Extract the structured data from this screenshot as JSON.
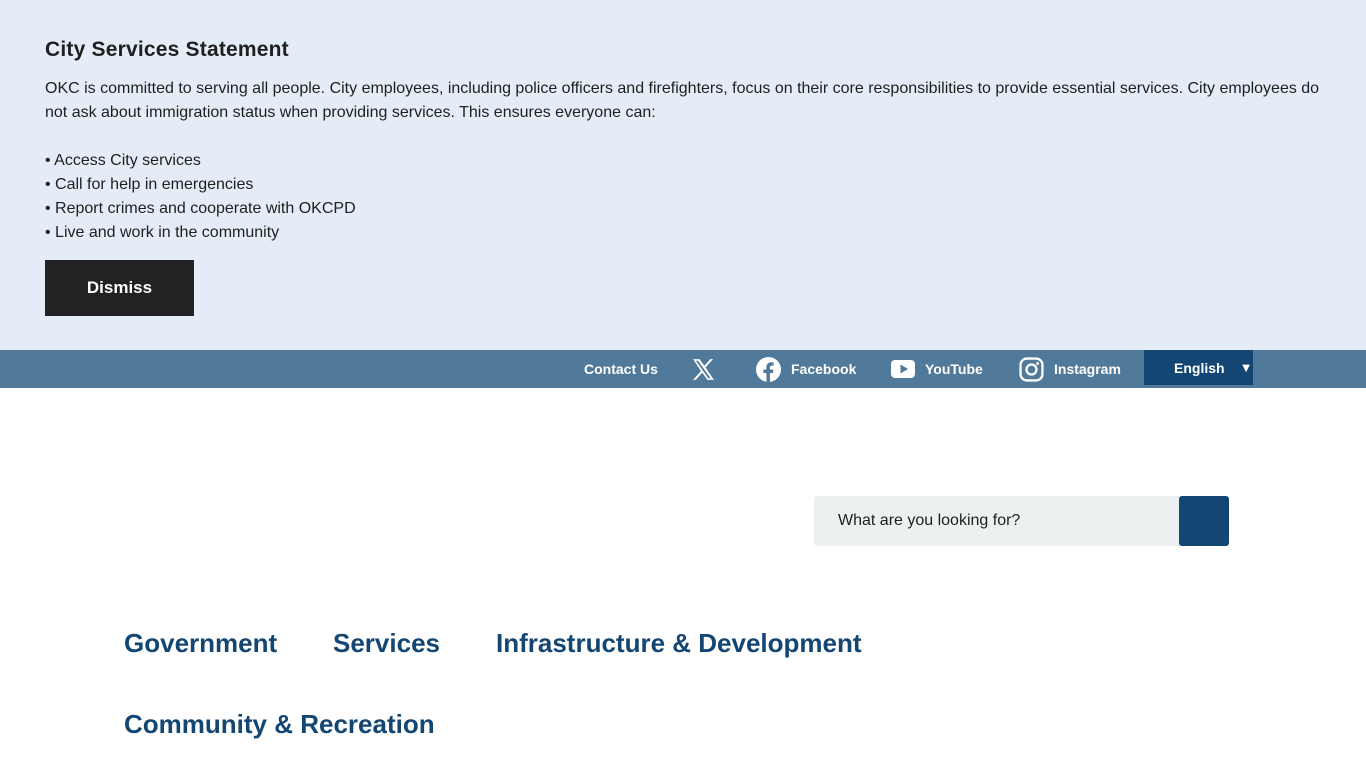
{
  "alert": {
    "title": "City Services Statement",
    "body": "OKC is committed to serving all people. City employees, including police officers and firefighters, focus on their core responsibilities to provide essential services. City employees do not ask about immigration status when providing services. This ensures everyone can:",
    "bullets": [
      "• Access City services",
      "• Call for help in emergencies",
      "• Report crimes and cooperate with OKCPD",
      "• Live and work in the community"
    ],
    "dismiss_label": "Dismiss"
  },
  "topbar": {
    "contact_label": "Contact Us",
    "x_icon": "x-icon",
    "facebook": {
      "icon": "facebook-icon",
      "label": "Facebook"
    },
    "youtube": {
      "icon": "youtube-icon",
      "label": "YouTube"
    },
    "instagram": {
      "icon": "instagram-icon",
      "label": "Instagram"
    },
    "language": {
      "selected": "English",
      "icon": "caret-down-icon"
    }
  },
  "search": {
    "placeholder": "What are you looking for?",
    "button_icon": "search-icon"
  },
  "nav": {
    "items": [
      "Government",
      "Services",
      "Infrastructure & Development",
      "Community & Recreation"
    ]
  },
  "colors": {
    "alert_bg": "#e3ecf7",
    "topbar_bg": "#517999",
    "brand_blue": "#134673",
    "dismiss_bg": "#222222",
    "search_bg": "#edf0f0"
  }
}
